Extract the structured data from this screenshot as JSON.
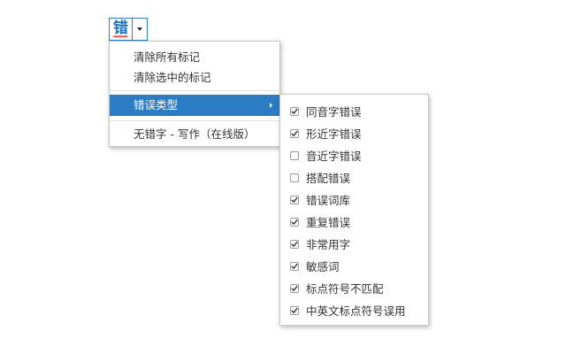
{
  "toolbar": {
    "button_glyph": "错",
    "accent_color": "#2a7fd4",
    "squiggle_color": "#e02020"
  },
  "menu": {
    "items": [
      {
        "label": "清除所有标记"
      },
      {
        "label": "清除选中的标记"
      },
      {
        "label": "错误类型",
        "active": true,
        "has_submenu": true
      },
      {
        "label": "无错字 - 写作（在线版）"
      }
    ],
    "active_color": "#2b7cc2"
  },
  "submenu": {
    "items": [
      {
        "label": "同音字错误",
        "checked": true
      },
      {
        "label": "形近字错误",
        "checked": true
      },
      {
        "label": "音近字错误",
        "checked": false
      },
      {
        "label": "搭配错误",
        "checked": false
      },
      {
        "label": "错误词库",
        "checked": true
      },
      {
        "label": "重复错误",
        "checked": true
      },
      {
        "label": "非常用字",
        "checked": true
      },
      {
        "label": "敏感词",
        "checked": true
      },
      {
        "label": "标点符号不匹配",
        "checked": true
      },
      {
        "label": "中英文标点符号误用",
        "checked": true
      }
    ]
  }
}
